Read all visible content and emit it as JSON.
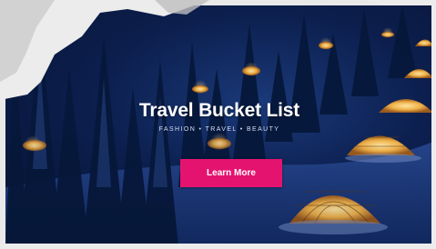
{
  "hero": {
    "title": "Travel Bucket List",
    "subtitle": "FASHION • TRAVEL • BEAUTY",
    "cta_label": "Learn More"
  },
  "colors": {
    "cta_background": "#e4136f",
    "night_sky": "#0c1f4f",
    "igloo_glow": "#f2b34a"
  }
}
